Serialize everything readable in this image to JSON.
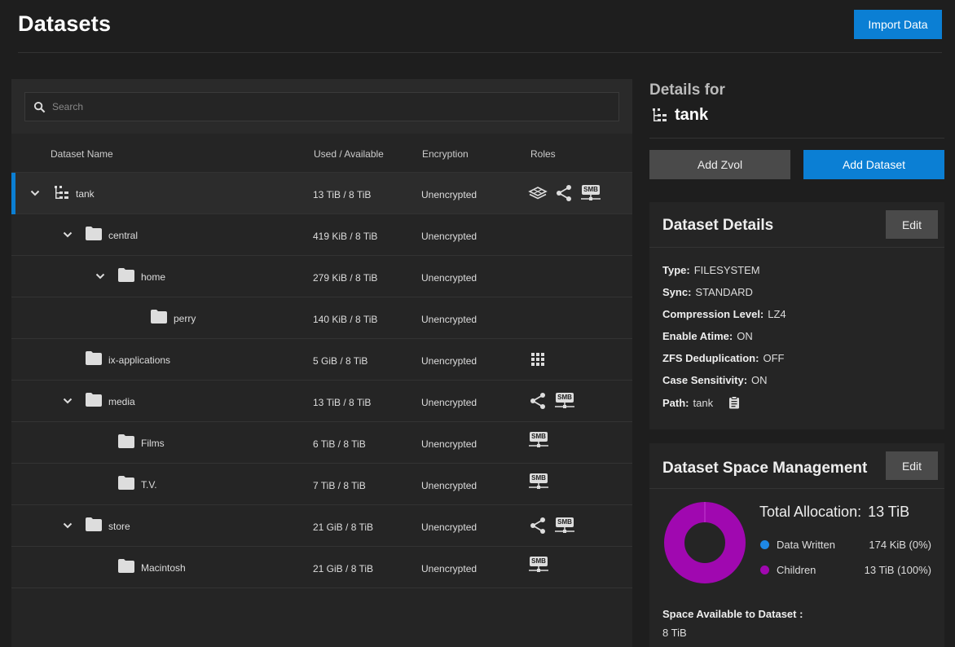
{
  "header": {
    "title": "Datasets",
    "import_label": "Import Data"
  },
  "search": {
    "placeholder": "Search"
  },
  "table": {
    "columns": [
      "Dataset Name",
      "Used / Available",
      "Encryption",
      "Roles"
    ],
    "rows": [
      {
        "name": "tank",
        "used": "13 TiB / 8 TiB",
        "encryption": "Unencrypted"
      },
      {
        "name": "central",
        "used": "419 KiB / 8 TiB",
        "encryption": "Unencrypted"
      },
      {
        "name": "home",
        "used": "279 KiB / 8 TiB",
        "encryption": "Unencrypted"
      },
      {
        "name": "perry",
        "used": "140 KiB / 8 TiB",
        "encryption": "Unencrypted"
      },
      {
        "name": "ix-applications",
        "used": "5 GiB / 8 TiB",
        "encryption": "Unencrypted"
      },
      {
        "name": "media",
        "used": "13 TiB / 8 TiB",
        "encryption": "Unencrypted"
      },
      {
        "name": "Films",
        "used": "6 TiB / 8 TiB",
        "encryption": "Unencrypted"
      },
      {
        "name": "T.V.",
        "used": "7 TiB / 8 TiB",
        "encryption": "Unencrypted"
      },
      {
        "name": "store",
        "used": "21 GiB / 8 TiB",
        "encryption": "Unencrypted"
      },
      {
        "name": "Macintosh",
        "used": "21 GiB / 8 TiB",
        "encryption": "Unencrypted"
      }
    ],
    "smb_badge": "SMB"
  },
  "details": {
    "heading": "Details for",
    "name": "tank",
    "add_zvol_label": "Add Zvol",
    "add_dataset_label": "Add Dataset"
  },
  "dataset_details": {
    "title": "Dataset Details",
    "edit_label": "Edit",
    "fields": [
      {
        "key": "Type:",
        "value": "FILESYSTEM"
      },
      {
        "key": "Sync:",
        "value": "STANDARD"
      },
      {
        "key": "Compression Level:",
        "value": "LZ4"
      },
      {
        "key": "Enable Atime:",
        "value": "ON"
      },
      {
        "key": "ZFS Deduplication:",
        "value": "OFF"
      },
      {
        "key": "Case Sensitivity:",
        "value": "ON"
      },
      {
        "key": "Path:",
        "value": "tank"
      }
    ]
  },
  "space": {
    "title": "Dataset Space Management",
    "edit_label": "Edit",
    "total_label": "Total Allocation:",
    "total_value": "13 TiB",
    "legend": [
      {
        "label": "Data Written",
        "value": "174 KiB (0%)",
        "color": "#1e88e5",
        "fraction": 0
      },
      {
        "label": "Children",
        "value": "13 TiB (100%)",
        "color": "#a008b0",
        "fraction": 1
      }
    ],
    "available_label": "Space Available to Dataset :",
    "available_value": "8 TiB"
  },
  "colors": {
    "accent": "#0b7fd4",
    "children": "#a008b0",
    "data_written": "#1e88e5"
  }
}
